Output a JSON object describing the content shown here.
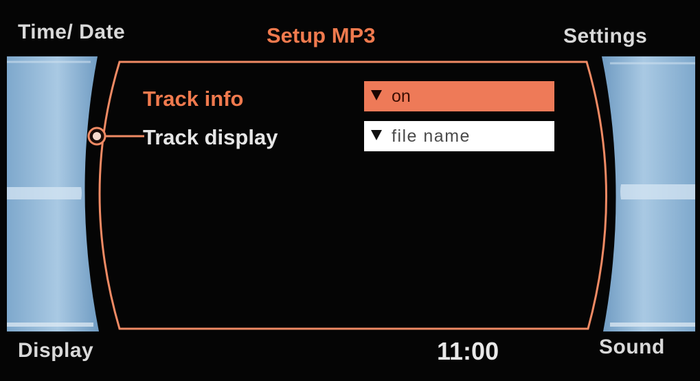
{
  "corners": {
    "top_left": "Time/ Date",
    "top_right": "Settings",
    "bottom_left": "Display",
    "bottom_right": "Sound"
  },
  "screen_title": "Setup MP3",
  "clock": "11:00",
  "menu": {
    "items": [
      {
        "label": "Track info",
        "value": "on",
        "state": "selected"
      },
      {
        "label": "Track display",
        "value": "file name",
        "state": "focused-cursor"
      }
    ]
  },
  "icons": {
    "dropdown": "chevron-down-icon",
    "cursor": "selection-cursor-icon"
  },
  "colors": {
    "accent": "#f07a4e",
    "frame": "#f08a64",
    "side_panel": "#8fb8d8",
    "background": "#050505"
  }
}
